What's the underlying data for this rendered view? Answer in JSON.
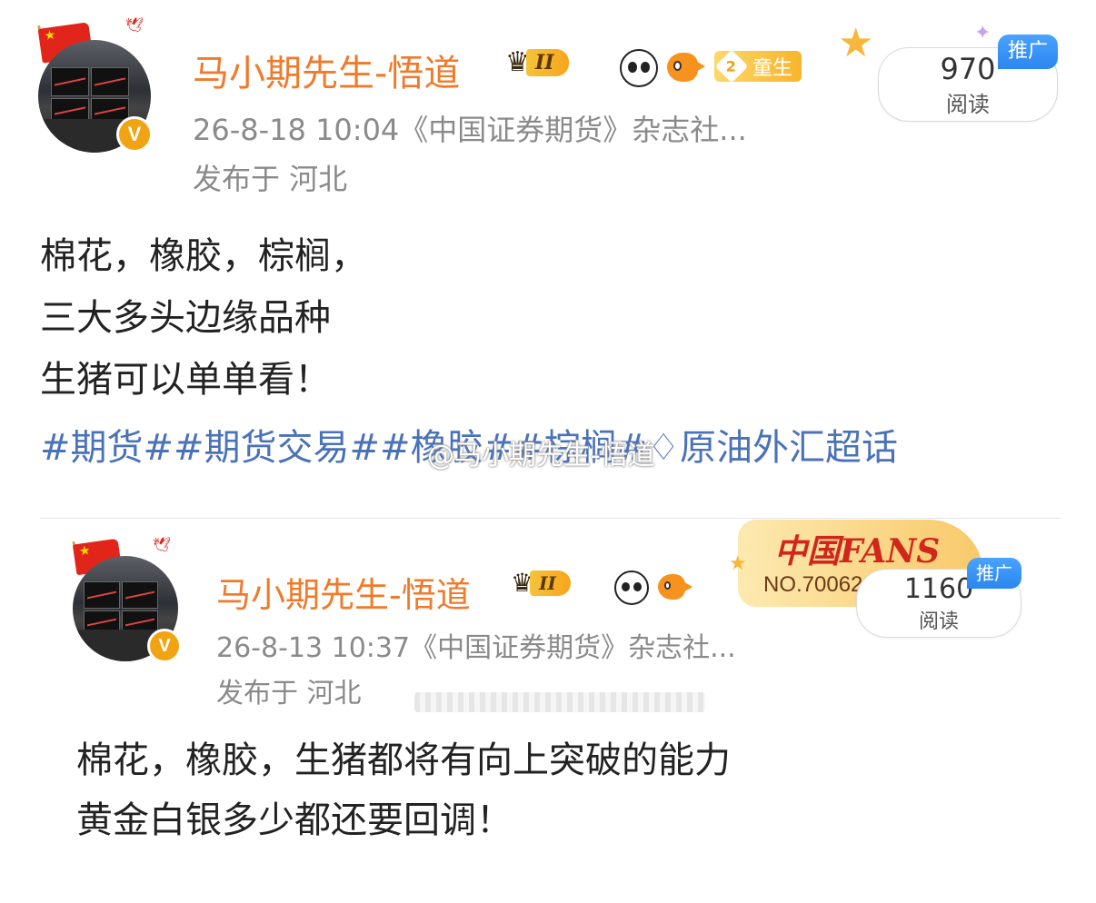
{
  "post1": {
    "author": "马小期先生-悟道",
    "level": "II",
    "tong_badge_num": "2",
    "tong_badge_label": "童生",
    "meta_line": "26-8-18 10:04《中国证券期货》杂志社...",
    "location": "发布于 河北",
    "reads_count": "970",
    "reads_label": "阅读",
    "promo_label": "推广",
    "body_lines": [
      "棉花，橡胶，棕榈，",
      "三大多头边缘品种",
      "生猪可以单单看！"
    ],
    "tags": "#期货##期货交易##橡胶##棕榈#",
    "supertopic": "原油外汇超话",
    "watermark": "@马小期先生-悟道"
  },
  "post2": {
    "author": "马小期先生-悟道",
    "level": "II",
    "meta_line": "26-8-13 10:37《中国证券期货》杂志社...",
    "location": "发布于 河北",
    "fans_title": "中国FANS",
    "fans_no": "NO.70062",
    "reads_count": "1160",
    "reads_label": "阅读",
    "promo_label": "推广",
    "body_lines": [
      "棉花，橡胶，生猪都将有向上突破的能力",
      "黄金白银多少都还要回调！"
    ]
  },
  "colors": {
    "name": "#f07a2a",
    "tag": "#4a72b8",
    "meta": "#8a8a8a",
    "promo": "#2b86ef",
    "verified": "#f2a312"
  },
  "icons": [
    "china-flag-icon",
    "verified-v-icon",
    "crown-level-icon",
    "panda-icon",
    "fish-icon",
    "diamond-icon",
    "supertopic-diamond-icon",
    "star-icon"
  ]
}
